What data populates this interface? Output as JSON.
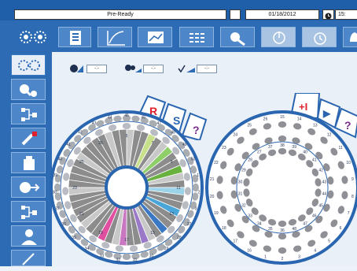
{
  "header": {
    "status": "Pre-Ready",
    "date": "01/18/2012",
    "time": "15:"
  },
  "toolbar": {
    "buttons": [
      "loading-icon",
      "curve-icon",
      "chart-icon",
      "list-icon",
      "maintenance-icon",
      "power-icon",
      "alarm-icon",
      "bell-icon"
    ]
  },
  "sidebar": {
    "items": [
      "settings-icon",
      "search-icon",
      "network-icon",
      "pipette-icon",
      "bottle-icon",
      "arrow-icon",
      "hierarchy-icon",
      "person-icon",
      "edit-icon"
    ]
  },
  "filters": {
    "f1": "-:-",
    "f2": "-:-",
    "f3": "-:-"
  },
  "left_tray": {
    "tabs": [
      "R",
      "S",
      "?"
    ],
    "outer_numbers": [
      "45",
      "46",
      "47",
      "48",
      "49",
      "50",
      "1",
      "2",
      "3",
      "27",
      "28",
      "29",
      "30",
      "31",
      "32",
      "33",
      "34",
      "35",
      "36",
      "37",
      "38",
      "39",
      "40",
      "41",
      "42",
      "43",
      "44"
    ],
    "inner_numbers": [
      "5",
      "7",
      "9",
      "11",
      "13",
      "15",
      "17",
      "19",
      "21",
      "23",
      "25",
      "26"
    ]
  },
  "right_tray": {
    "tabs": [
      "+I",
      "▶",
      "?"
    ],
    "outer_numbers": [
      "15",
      "14",
      "13",
      "12",
      "11",
      "10",
      "9",
      "8",
      "7",
      "6",
      "5",
      "4",
      "3",
      "2",
      "1",
      "16",
      "17",
      "18",
      "19",
      "20",
      "21",
      "22",
      "23",
      "24",
      "25",
      "26"
    ],
    "inner_numbers": [
      "38",
      "39",
      "40",
      "41",
      "42",
      "43",
      "44",
      "45",
      "46",
      "47",
      "48",
      "36",
      "35",
      "34",
      "33",
      "32",
      "31",
      "30",
      "29",
      "28",
      "27",
      "37"
    ]
  },
  "colors": {
    "accent": "#2d6cb5",
    "tab_red": "#e0202a",
    "tab_blue": "#2a65b0",
    "tab_question": "#7a2a8a"
  }
}
